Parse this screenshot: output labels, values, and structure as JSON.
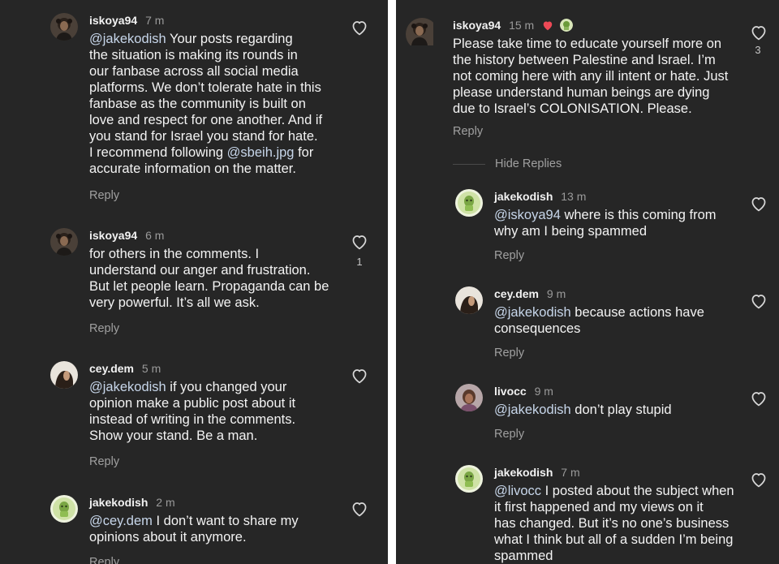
{
  "left_panel": {
    "comments": [
      {
        "username": "iskoya94",
        "time": "7 m",
        "lines": [
          [
            {
              "m": "@jakekodish"
            },
            {
              "t": " Your posts regarding"
            }
          ],
          [
            {
              "t": "the situation is making its rounds in"
            }
          ],
          [
            {
              "t": "our fanbase across all social media"
            }
          ],
          [
            {
              "t": "platforms. We don’t tolerate hate in this"
            }
          ],
          [
            {
              "t": "fanbase as the community is built on"
            }
          ],
          [
            {
              "t": "love and respect for one another. And if"
            }
          ],
          [
            {
              "t": "you stand for Israel you stand for hate."
            }
          ],
          [
            {
              "t": "I recommend following "
            },
            {
              "m": "@sbeih.jpg"
            },
            {
              "t": " for"
            }
          ],
          [
            {
              "t": "accurate information on the matter."
            }
          ]
        ],
        "reply_label": "Reply",
        "like_count": ""
      },
      {
        "username": "iskoya94",
        "time": "6 m",
        "lines": [
          [
            {
              "t": "for others in the comments. I"
            }
          ],
          [
            {
              "t": "understand our anger and frustration."
            }
          ],
          [
            {
              "t": "But let people learn. Propaganda can be"
            }
          ],
          [
            {
              "t": "very powerful. It’s all we ask."
            }
          ]
        ],
        "reply_label": "Reply",
        "like_count": "1"
      },
      {
        "username": "cey.dem",
        "time": "5 m",
        "lines": [
          [
            {
              "m": "@jakekodish"
            },
            {
              "t": " if you changed your"
            }
          ],
          [
            {
              "t": "opinion make a public post about it"
            }
          ],
          [
            {
              "t": "instead of writing in the comments."
            }
          ],
          [
            {
              "t": "Show your stand. Be a man."
            }
          ]
        ],
        "reply_label": "Reply",
        "like_count": ""
      },
      {
        "username": "jakekodish",
        "time": "2 m",
        "lines": [
          [
            {
              "m": "@cey.dem"
            },
            {
              "t": " I don’t want to share my"
            }
          ],
          [
            {
              "t": "opinions about it anymore."
            }
          ]
        ],
        "reply_label": "Reply",
        "like_count": ""
      }
    ]
  },
  "right_panel": {
    "parent_comment": {
      "username": "iskoya94",
      "time": "15 m",
      "lines": [
        [
          {
            "t": "Please take time to educate yourself more on"
          }
        ],
        [
          {
            "t": "the history between Palestine and Israel. I’m"
          }
        ],
        [
          {
            "t": "not coming here with any ill intent or hate. Just"
          }
        ],
        [
          {
            "t": "please understand human beings are dying"
          }
        ],
        [
          {
            "t": "due to Israel’s COLONISATION. Please."
          }
        ]
      ],
      "reply_label": "Reply",
      "like_count": "3"
    },
    "hide_replies_label": "Hide Replies",
    "replies": [
      {
        "username": "jakekodish",
        "time": "13 m",
        "lines": [
          [
            {
              "m": "@iskoya94"
            },
            {
              "t": " where is this coming from"
            }
          ],
          [
            {
              "t": "why am I being spammed"
            }
          ]
        ],
        "reply_label": "Reply"
      },
      {
        "username": "cey.dem",
        "time": "9 m",
        "lines": [
          [
            {
              "m": "@jakekodish"
            },
            {
              "t": " because actions have"
            }
          ],
          [
            {
              "t": "consequences"
            }
          ]
        ],
        "reply_label": "Reply"
      },
      {
        "username": "livocc",
        "time": "9 m",
        "lines": [
          [
            {
              "m": "@jakekodish"
            },
            {
              "t": " don’t play stupid"
            }
          ]
        ],
        "reply_label": "Reply"
      },
      {
        "username": "jakekodish",
        "time": "7 m",
        "lines": [
          [
            {
              "m": "@livocc"
            },
            {
              "t": " I posted about the subject when"
            }
          ],
          [
            {
              "t": "it first happened and my views on it"
            }
          ],
          [
            {
              "t": "has changed. But it’s no one’s business"
            }
          ],
          [
            {
              "t": "what I think but all of a sudden I’m being"
            }
          ],
          [
            {
              "t": "spammed"
            }
          ]
        ],
        "reply_label": ""
      }
    ]
  },
  "colors": {
    "background": "#262626",
    "text": "#f3f3f3",
    "mention": "#c7d6ea",
    "muted": "#a0a0a0",
    "heart_red": "#ed4956"
  },
  "icons": {
    "like": "heart-outline-icon",
    "liked_by_author": "heart-filled-icon"
  }
}
